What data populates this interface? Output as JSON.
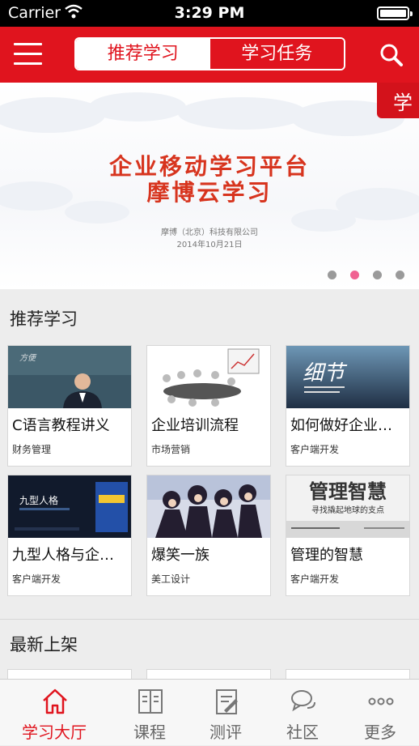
{
  "status_bar": {
    "carrier": "Carrier",
    "time": "3:29 PM"
  },
  "nav": {
    "segments": [
      "推荐学习",
      "学习任务"
    ],
    "active_segment": 0
  },
  "banner": {
    "badge": "学",
    "title_line1": "企业移动学习平台",
    "title_line2": "摩博云学习",
    "company": "摩博（北京）科技有限公司",
    "date": "2014年10月21日",
    "page_count": 4,
    "active_page": 1
  },
  "recommended": {
    "title": "推荐学习",
    "items": [
      {
        "title": "C语言教程讲义",
        "category": "财务管理",
        "thumb": "lecture-photo"
      },
      {
        "title": "企业培训流程",
        "category": "市场营销",
        "thumb": "meeting-photo"
      },
      {
        "title": "如何做好企业…",
        "category": "客户端开发",
        "thumb": "xijie-poster",
        "thumb_text": "细节"
      },
      {
        "title": "九型人格与企…",
        "category": "客户端开发",
        "thumb": "enneagram-book",
        "thumb_text": "九型人格"
      },
      {
        "title": "爆笑一族",
        "category": "美工设计",
        "thumb": "anime-art"
      },
      {
        "title": "管理的智慧",
        "category": "客户端开发",
        "thumb": "wisdom-cover",
        "thumb_text": "管理智慧",
        "thumb_subtext": "寻找撬起地球的支点"
      }
    ]
  },
  "latest": {
    "title": "最新上架"
  },
  "tabbar": {
    "active": 0,
    "tabs": [
      {
        "label": "学习大厅",
        "icon": "home-icon"
      },
      {
        "label": "课程",
        "icon": "book-icon"
      },
      {
        "label": "测评",
        "icon": "clipboard-icon"
      },
      {
        "label": "社区",
        "icon": "chat-icon"
      },
      {
        "label": "更多",
        "icon": "more-icon"
      }
    ]
  },
  "colors": {
    "brand_red": "#e0141e",
    "dot_active": "#f06292",
    "dot_inactive": "#9a9a9a"
  }
}
